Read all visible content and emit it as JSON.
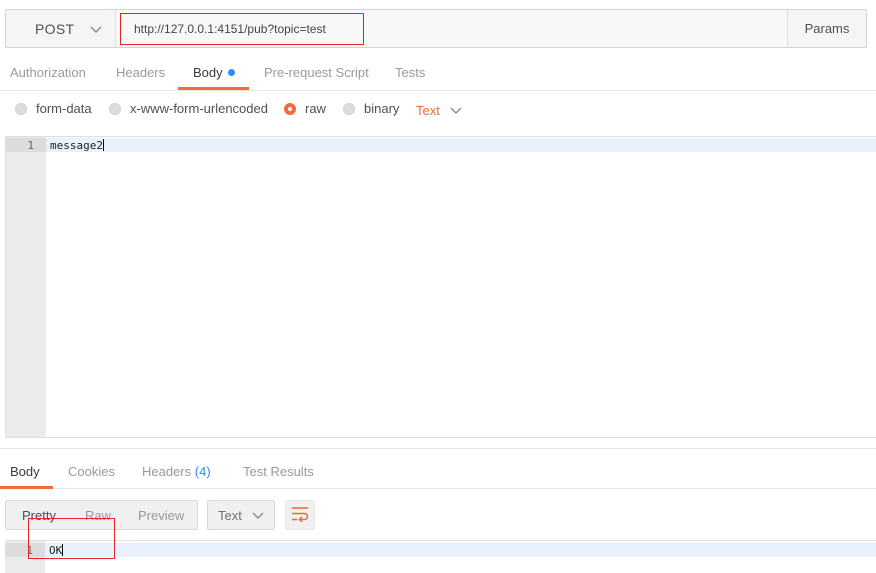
{
  "request": {
    "method": "POST",
    "url": "http://127.0.0.1:4151/pub?topic=test",
    "params_label": "Params"
  },
  "tabs": [
    {
      "label": "Authorization"
    },
    {
      "label": "Headers"
    },
    {
      "label": "Body"
    },
    {
      "label": "Pre-request Script"
    },
    {
      "label": "Tests"
    }
  ],
  "body_types": [
    {
      "label": "form-data",
      "selected": false
    },
    {
      "label": "x-www-form-urlencoded",
      "selected": false
    },
    {
      "label": "raw",
      "selected": true
    },
    {
      "label": "binary",
      "selected": false
    }
  ],
  "raw_format": "Text",
  "editor": {
    "lines": [
      {
        "number": "1",
        "text": "message2"
      }
    ]
  },
  "response": {
    "tabs": [
      {
        "label": "Body"
      },
      {
        "label": "Cookies"
      },
      {
        "label": "Headers",
        "count": "(4)"
      },
      {
        "label": "Test Results"
      }
    ],
    "view_modes": [
      "Pretty",
      "Raw",
      "Preview"
    ],
    "format": "Text",
    "lines": [
      {
        "number": "1",
        "text": "OK"
      }
    ]
  },
  "colors": {
    "accent": "#f26b3a",
    "blue": "#2a8ff5",
    "annotation_red": "#e3232b"
  },
  "icons": [
    "chevron-down-icon",
    "wrap-lines-icon"
  ]
}
